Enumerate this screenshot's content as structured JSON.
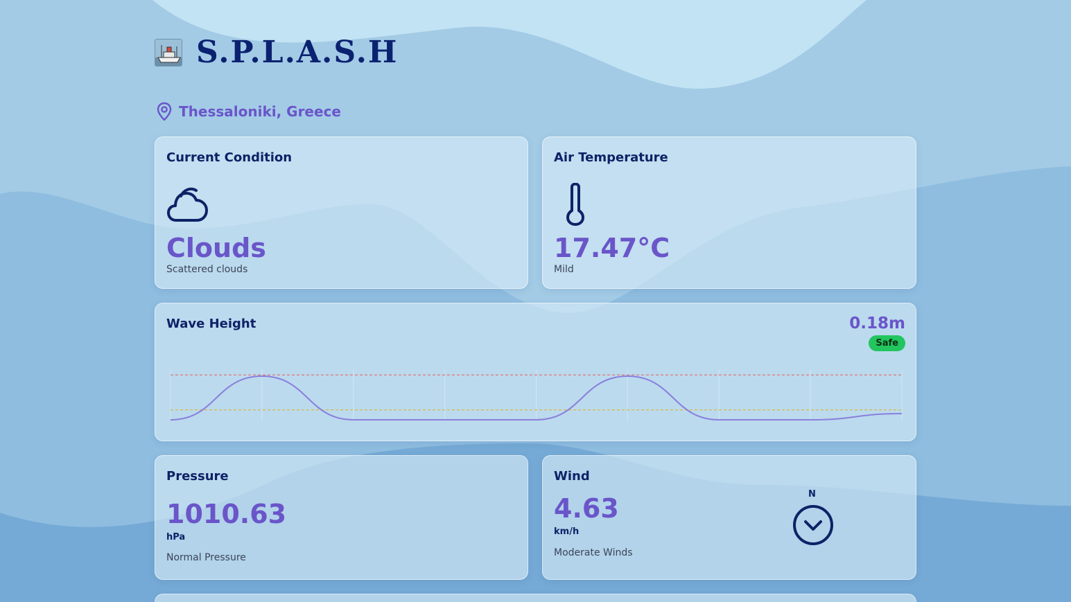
{
  "app": {
    "title": "S.P.L.A.S.H"
  },
  "location": {
    "name": "Thessaloniki, Greece",
    "icon": "map-pin-icon"
  },
  "colors": {
    "accent": "#6a55c9",
    "navy": "#0d2266",
    "safe_badge": "#22c55e",
    "danger_line": "#e26a6a",
    "warning_line": "#d9b93c"
  },
  "condition": {
    "title": "Current Condition",
    "icon": "cloud-icon",
    "value": "Clouds",
    "description": "Scattered clouds"
  },
  "temperature": {
    "title": "Air Temperature",
    "icon": "thermometer-icon",
    "value": "17.47°C",
    "description": "Mild"
  },
  "wave": {
    "title": "Wave Height",
    "value": "0.18m",
    "status": "Safe",
    "chart_data": {
      "type": "line",
      "title": "",
      "xlabel": "",
      "ylabel": "",
      "series": [
        {
          "values": [
            0.0,
            0.35,
            0.0,
            0.0,
            0.0,
            0.35,
            0.0,
            0.0,
            0.05
          ]
        }
      ],
      "thresholds": [
        {
          "value": 0.36,
          "color": "#e26a6a",
          "style": "dashed"
        },
        {
          "value": 0.08,
          "color": "#d9b93c",
          "style": "dashed"
        }
      ],
      "ylim": [
        0,
        0.4
      ],
      "grid": true,
      "axes_visible": false
    }
  },
  "pressure": {
    "title": "Pressure",
    "value": "1010.63",
    "unit": "hPa",
    "description": "Normal Pressure"
  },
  "wind": {
    "title": "Wind",
    "value": "4.63",
    "unit": "km/h",
    "description": "Moderate Winds",
    "compass_label": "N",
    "direction_icon": "chevron-down-circle-icon"
  }
}
